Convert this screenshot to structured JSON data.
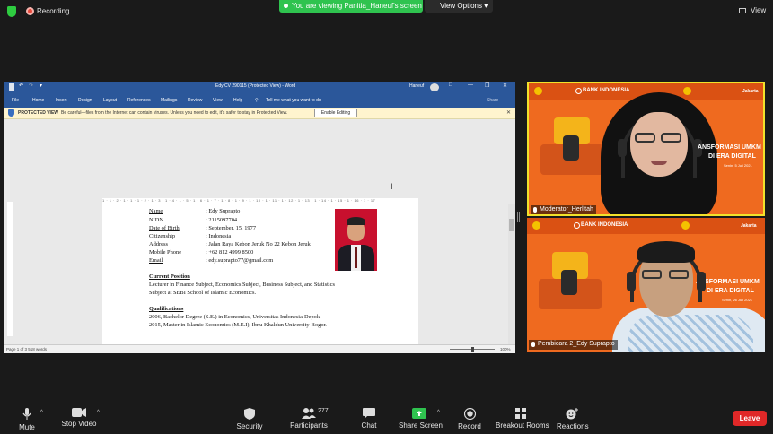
{
  "topbar": {
    "recording_label": "Recording",
    "share_banner": "You are viewing Panitia_Haneuf's screen",
    "view_options": "View Options",
    "view_label": "View"
  },
  "word": {
    "title": "Edy CV 290115 (Protected View) - Word",
    "user": "Haneuf",
    "tabs": [
      "File",
      "Home",
      "Insert",
      "Design",
      "Layout",
      "References",
      "Mailings",
      "Review",
      "View",
      "Help"
    ],
    "tell_me": "Tell me what you want to do",
    "share": "Share",
    "protected_label": "PROTECTED VIEW",
    "protected_msg": "Be careful—files from the Internet can contain viruses. Unless you need to edit, it's safer to stay in Protected View.",
    "enable_editing": "Enable Editing",
    "ruler": "1 · 1 · 2 · 1 · 1 · 1 · 2 · 1 · 3 · 1 · 4 · 1 · 5 · 1 · 6 · 1 · 7 · 1 · 8 · 1 · 9 · 1 · 10 · 1 · 11 · 1 · 12 · 1 · 13 · 1 · 14 · 1 · 15 · 1 · 16 · 1 · 17",
    "status": "Page 1 of 3    518 words",
    "zoom": "100%"
  },
  "cv": {
    "fields": [
      {
        "label": "Name",
        "value": ": Edy Suprapto"
      },
      {
        "label": "NIDN",
        "value": ": 2115097704"
      },
      {
        "label": "Date of Birth",
        "value": ": September, 15, 1977"
      },
      {
        "label": "Citizenship",
        "value": ": Indonesia"
      },
      {
        "label": "Address",
        "value": ": Jalan Raya Kebon Jeruk No 22 Kebon Jeruk"
      },
      {
        "label": "Mobile Phone",
        "value": ": +62 812 4999 8500"
      },
      {
        "label": "Email",
        "value": ": edy.suprapto77@gmail.com"
      }
    ],
    "position_heading": "Current Position",
    "position_line1": "Lecturer in Finance Subject, Economics Subject, Business Subject, and Statistics",
    "position_line2": "Subject at SEBI School of Islamic Economics.",
    "qual_heading": "Qualifications",
    "qual_line1": "2006, Bachelor Degree  (S.E.) in Economics, Universitas Indonesia-Depok",
    "qual_line2": "2015, Master in Islamic Economics (M.E.I), Ibnu Khaldun University-Bogor."
  },
  "tiles": [
    {
      "name": "Moderator_Herlitah",
      "bank": "BANK INDONESIA",
      "title": "ANSFORMASI UMKM",
      "subtitle": "DI ERA DIGITAL",
      "date": "Senin, 5 Juli 2021",
      "jakarta": "Jakarta"
    },
    {
      "name": "Pembicara 2_Edy Suprapto",
      "bank": "BANK INDONESIA",
      "title": "ANSFORMASI UMKM",
      "subtitle": "DI ERA DIGITAL",
      "date": "Senin, 26 Juli 2021",
      "jakarta": "Jakarta"
    }
  ],
  "toolbar": {
    "mute": "Mute",
    "stop_video": "Stop Video",
    "security": "Security",
    "participants": "Participants",
    "participants_count": "277",
    "chat": "Chat",
    "share_screen": "Share Screen",
    "record": "Record",
    "breakout": "Breakout Rooms",
    "reactions": "Reactions",
    "leave": "Leave"
  },
  "colors": {
    "share_green": "#2fc34f",
    "word_blue": "#2b579a",
    "tile_orange": "#ef6a1f",
    "active_speaker": "#f2e22b",
    "leave_red": "#e02828"
  }
}
